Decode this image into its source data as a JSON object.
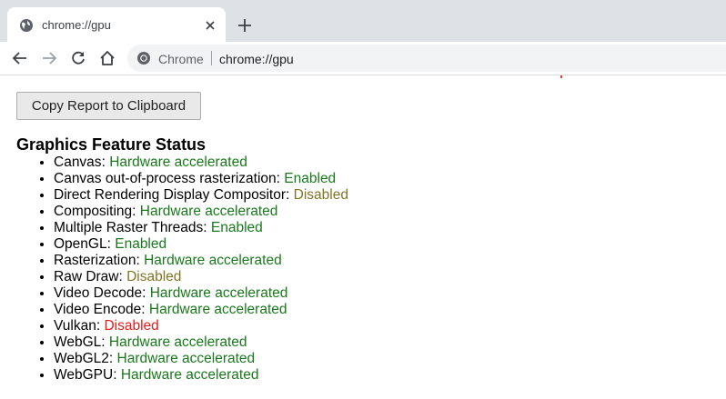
{
  "browser": {
    "tab_title": "chrome://gpu",
    "omnibox_chip": "Chrome",
    "omnibox_url": "chrome://gpu"
  },
  "page": {
    "copy_button_label": "Copy Report to Clipboard",
    "section_title": "Graphics Feature Status",
    "features": [
      {
        "name": "Canvas",
        "status": "Hardware accelerated",
        "status_color": "green"
      },
      {
        "name": "Canvas out-of-process rasterization",
        "status": "Enabled",
        "status_color": "green"
      },
      {
        "name": "Direct Rendering Display Compositor",
        "status": "Disabled",
        "status_color": "olive"
      },
      {
        "name": "Compositing",
        "status": "Hardware accelerated",
        "status_color": "green"
      },
      {
        "name": "Multiple Raster Threads",
        "status": "Enabled",
        "status_color": "green"
      },
      {
        "name": "OpenGL",
        "status": "Enabled",
        "status_color": "green"
      },
      {
        "name": "Rasterization",
        "status": "Hardware accelerated",
        "status_color": "green"
      },
      {
        "name": "Raw Draw",
        "status": "Disabled",
        "status_color": "olive"
      },
      {
        "name": "Video Decode",
        "status": "Hardware accelerated",
        "status_color": "green"
      },
      {
        "name": "Video Encode",
        "status": "Hardware accelerated",
        "status_color": "green"
      },
      {
        "name": "Vulkan",
        "status": "Disabled",
        "status_color": "red"
      },
      {
        "name": "WebGL",
        "status": "Hardware accelerated",
        "status_color": "green"
      },
      {
        "name": "WebGL2",
        "status": "Hardware accelerated",
        "status_color": "green"
      },
      {
        "name": "WebGPU",
        "status": "Hardware accelerated",
        "status_color": "green"
      }
    ]
  },
  "colors": {
    "green": "#19781c",
    "olive": "#807525",
    "red": "#e51c1c",
    "tabstrip": "#dee1e6",
    "omnibox": "#f1f3f4"
  },
  "icons": {
    "favicon": "globe-icon",
    "tab_close": "close-icon",
    "new_tab": "plus-icon",
    "back": "back-arrow-icon",
    "forward": "forward-arrow-icon",
    "reload": "reload-icon",
    "home": "home-icon",
    "site_info": "chrome-logo-icon"
  }
}
